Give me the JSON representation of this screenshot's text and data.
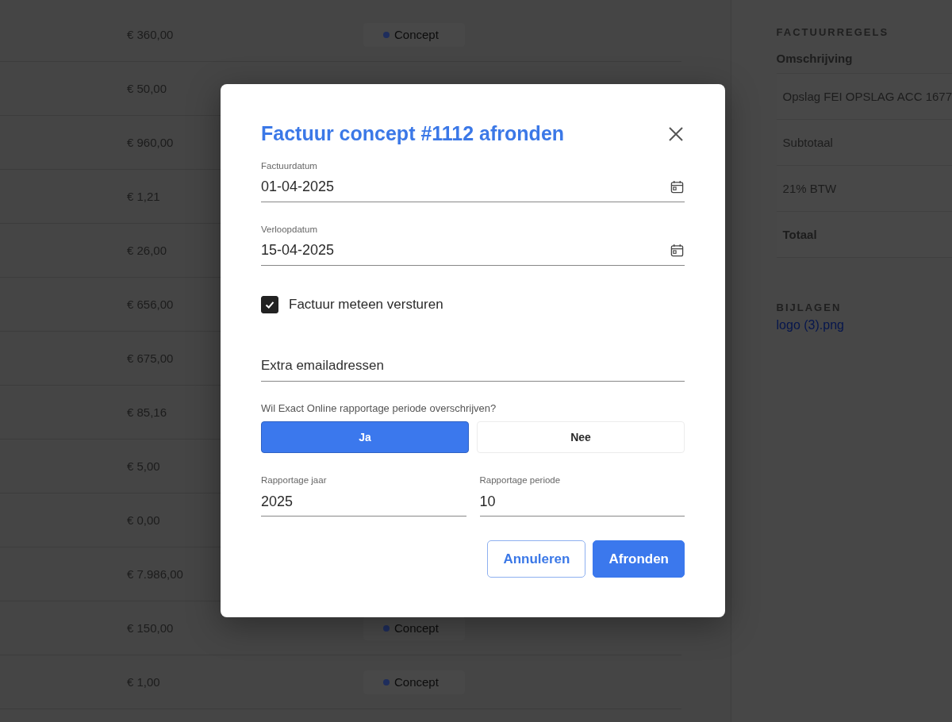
{
  "invoices": [
    {
      "amount": "€ 360,00",
      "status": "Concept"
    },
    {
      "amount": "€ 50,00"
    },
    {
      "amount": "€ 960,00"
    },
    {
      "amount": "€ 1,21"
    },
    {
      "amount": "€ 26,00"
    },
    {
      "amount": "€ 656,00"
    },
    {
      "amount": "€ 675,00"
    },
    {
      "amount": "€ 85,16"
    },
    {
      "amount": "€ 5,00"
    },
    {
      "amount": "€ 0,00"
    },
    {
      "amount": "€ 7.986,00"
    },
    {
      "amount": "€ 150,00",
      "status": "Concept"
    },
    {
      "amount": "€ 1,00",
      "status": "Concept"
    }
  ],
  "side_panel": {
    "lines_heading": "FACTUURREGELS",
    "column_header": "Omschrijving",
    "lines": [
      {
        "text": "Opslag FEI OPSLAG ACC 1677",
        "bold": false
      },
      {
        "text": "Subtotaal",
        "bold": false
      },
      {
        "text": "21% BTW",
        "bold": false
      },
      {
        "text": "Totaal",
        "bold": true
      }
    ],
    "attachments_heading": "BIJLAGEN",
    "attachments": [
      "logo (3).png"
    ]
  },
  "dialog": {
    "title": "Factuur concept #1112 afronden",
    "invoice_date": {
      "label": "Factuurdatum",
      "value": "01-04-2025"
    },
    "due_date": {
      "label": "Verloopdatum",
      "value": "15-04-2025"
    },
    "send_now": {
      "label": "Factuur meteen versturen",
      "checked": true
    },
    "extra_emails": {
      "placeholder": "Extra emailadressen"
    },
    "override_question": "Wil Exact Online rapportage periode overschrijven?",
    "override_options": [
      {
        "label": "Ja",
        "selected": true
      },
      {
        "label": "Nee",
        "selected": false
      }
    ],
    "report_year": {
      "label": "Rapportage jaar",
      "value": "2025"
    },
    "report_period": {
      "label": "Rapportage periode",
      "value": "10"
    },
    "buttons": [
      {
        "label": "Annuleren",
        "kind": "secondary"
      },
      {
        "label": "Afronden",
        "kind": "primary"
      }
    ]
  }
}
